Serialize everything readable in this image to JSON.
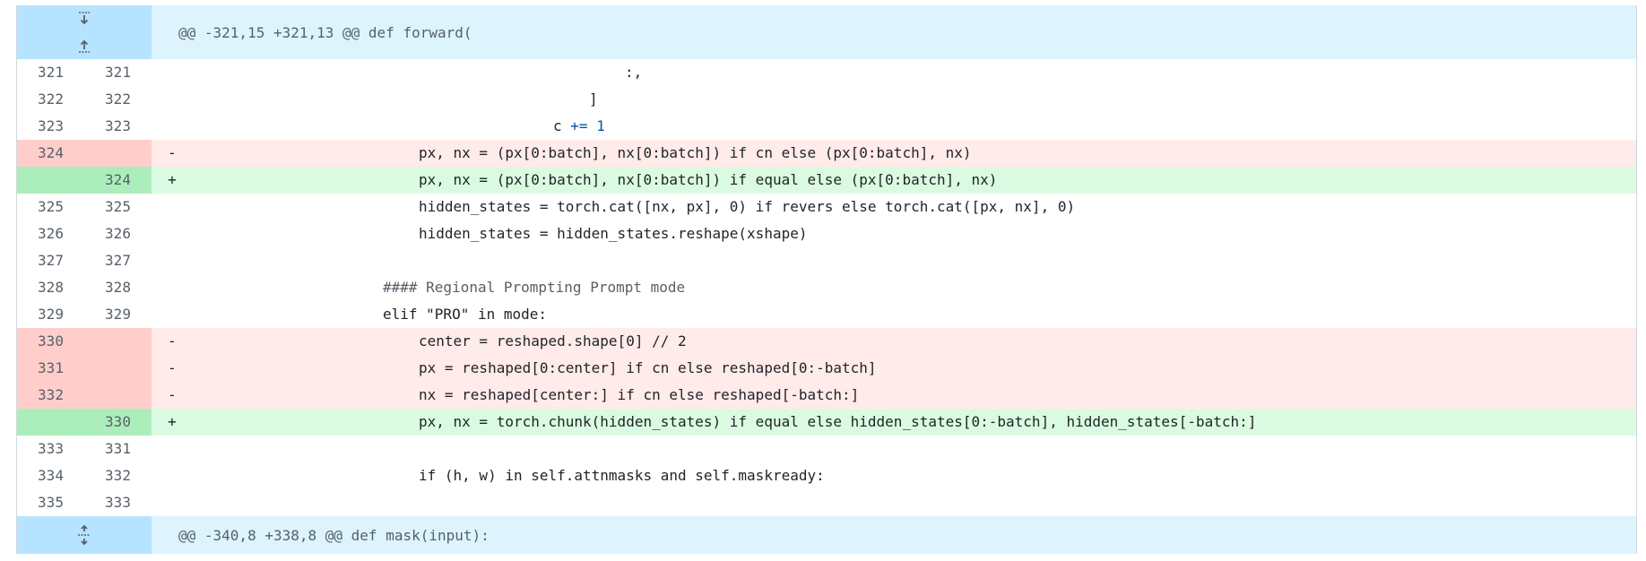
{
  "hunks": {
    "top": "@@ -321,15 +321,13 @@ def forward(",
    "bottom": "@@ -340,8 +338,8 @@ def mask(input):"
  },
  "icons": {
    "expand_down": "expand-down-icon",
    "expand_up": "expand-up-icon",
    "expand_all": "unfold-icon"
  },
  "rows": [
    {
      "old": "321",
      "new": "321",
      "sign": "",
      "type": "ctx"
    },
    {
      "old": "322",
      "new": "322",
      "sign": "",
      "type": "ctx"
    },
    {
      "old": "323",
      "new": "323",
      "sign": "",
      "type": "ctx"
    },
    {
      "old": "324",
      "new": "",
      "sign": "-",
      "type": "del"
    },
    {
      "old": "",
      "new": "324",
      "sign": "+",
      "type": "add"
    },
    {
      "old": "325",
      "new": "325",
      "sign": "",
      "type": "ctx"
    },
    {
      "old": "326",
      "new": "326",
      "sign": "",
      "type": "ctx"
    },
    {
      "old": "327",
      "new": "327",
      "sign": "",
      "type": "ctx"
    },
    {
      "old": "328",
      "new": "328",
      "sign": "",
      "type": "ctx"
    },
    {
      "old": "329",
      "new": "329",
      "sign": "",
      "type": "ctx"
    },
    {
      "old": "330",
      "new": "",
      "sign": "-",
      "type": "del"
    },
    {
      "old": "331",
      "new": "",
      "sign": "-",
      "type": "del"
    },
    {
      "old": "332",
      "new": "",
      "sign": "-",
      "type": "del"
    },
    {
      "old": "",
      "new": "330",
      "sign": "+",
      "type": "add"
    },
    {
      "old": "333",
      "new": "331",
      "sign": "",
      "type": "ctx"
    },
    {
      "old": "334",
      "new": "332",
      "sign": "",
      "type": "ctx"
    },
    {
      "old": "335",
      "new": "333",
      "sign": "",
      "type": "ctx"
    }
  ],
  "code": {
    "l0": ":,",
    "l1": "]",
    "l2_a": "c",
    "l2_b": "+=",
    "l2_c": "1",
    "l3": "px, nx = (px[0:batch], nx[0:batch]) if cn else (px[0:batch], nx)",
    "l4": "px, nx = (px[0:batch], nx[0:batch]) if equal else (px[0:batch], nx)",
    "l5": "hidden_states = torch.cat([nx, px], 0) if revers else torch.cat([px, nx], 0)",
    "l6": "hidden_states = hidden_states.reshape(xshape)",
    "l7": "",
    "l8": "#### Regional Prompting Prompt mode",
    "l9": "elif \"PRO\" in mode:",
    "l10": "center = reshaped.shape[0] // 2",
    "l11": "px = reshaped[0:center] if cn else reshaped[0:-batch]",
    "l12": "nx = reshaped[center:] if cn else reshaped[-batch:]",
    "l13": "px, nx = torch.chunk(hidden_states) if equal else hidden_states[0:-batch], hidden_states[-batch:]",
    "l14": "",
    "l15": "if (h, w) in self.attnmasks and self.maskready:",
    "l16": ""
  },
  "colors": {
    "del_bg": "#ffebe9",
    "del_num_bg": "#ffcecb",
    "add_bg": "#dafbe1",
    "add_num_bg": "#aceebb",
    "hunk_bg": "#ddf4ff",
    "expander_bg": "#b6e3ff"
  }
}
